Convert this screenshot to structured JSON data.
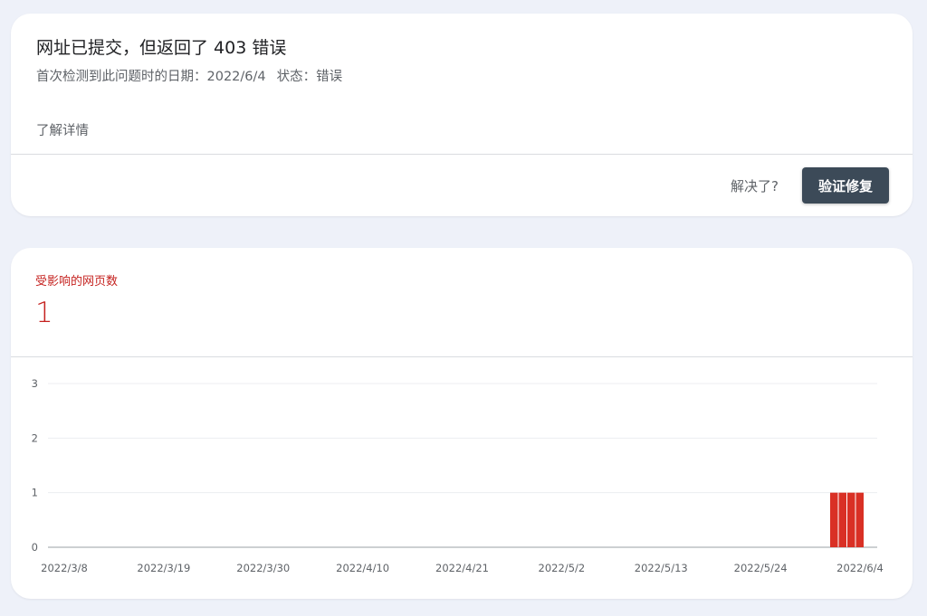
{
  "issue": {
    "title": "网址已提交，但返回了 403 错误",
    "first_detected_label": "首次检测到此问题时的日期：",
    "first_detected_value": "2022/6/4",
    "status_label": "状态：",
    "status_value": "错误",
    "learn_more": "了解详情",
    "resolved_question": "解决了?",
    "validate_button": "验证修复"
  },
  "metric": {
    "label": "受影响的网页数",
    "value": "1"
  },
  "colors": {
    "accent_red": "#c5221f",
    "bar_red": "#d93025",
    "button_bg": "#3c4a58"
  },
  "chart_data": {
    "type": "bar",
    "title": "",
    "xlabel": "",
    "ylabel": "",
    "ylim": [
      0,
      3
    ],
    "yticks": [
      "0",
      "1",
      "2",
      "3"
    ],
    "xticks": [
      "2022/3/8",
      "2022/3/19",
      "2022/3/30",
      "2022/4/10",
      "2022/4/21",
      "2022/5/2",
      "2022/5/13",
      "2022/5/24",
      "2022/6/4"
    ],
    "categories": [
      "2022/6/1",
      "2022/6/2",
      "2022/6/3",
      "2022/6/4"
    ],
    "values": [
      1,
      1,
      1,
      1
    ],
    "grid": true
  }
}
